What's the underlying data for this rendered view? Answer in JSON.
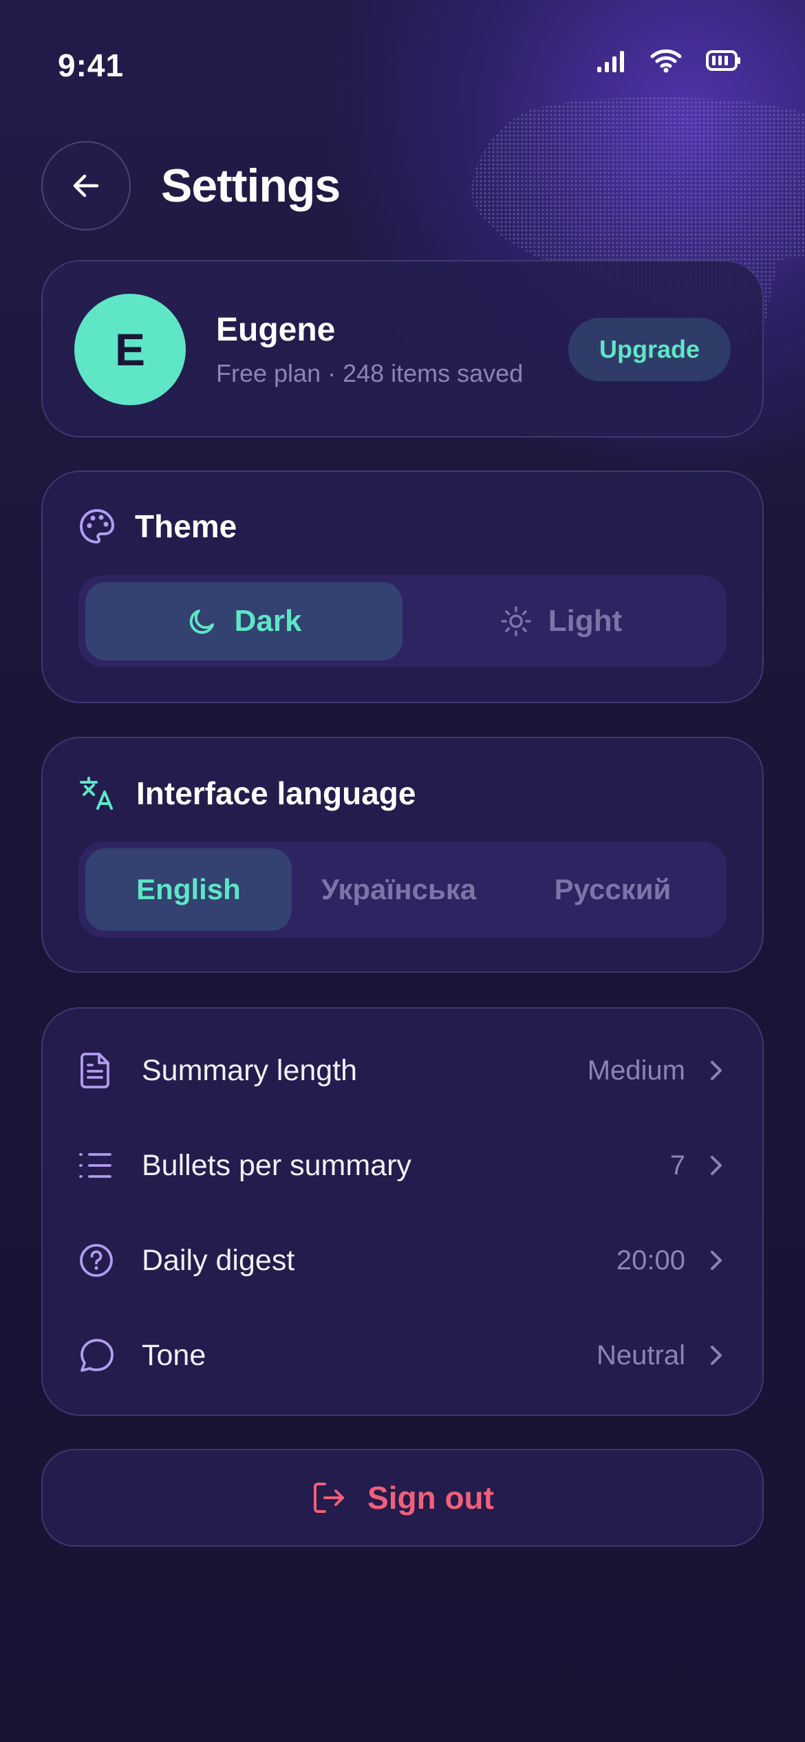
{
  "status_bar": {
    "time": "9:41"
  },
  "header": {
    "title": "Settings"
  },
  "profile": {
    "initial": "E",
    "name": "Eugene",
    "subtitle": "Free plan · 248 items saved",
    "upgrade_label": "Upgrade"
  },
  "theme": {
    "title": "Theme",
    "options": [
      {
        "label": "Dark",
        "icon": "moon-icon",
        "selected": true
      },
      {
        "label": "Light",
        "icon": "sun-icon",
        "selected": false
      }
    ]
  },
  "language": {
    "title": "Interface language",
    "options": [
      {
        "label": "English",
        "selected": true
      },
      {
        "label": "Українська",
        "selected": false
      },
      {
        "label": "Русский",
        "selected": false
      }
    ]
  },
  "preferences": {
    "items": [
      {
        "label": "Summary length",
        "value": "Medium",
        "icon": "document-icon"
      },
      {
        "label": "Bullets per summary",
        "value": "7",
        "icon": "list-icon"
      },
      {
        "label": "Daily digest",
        "value": "20:00",
        "icon": "help-circle-icon"
      },
      {
        "label": "Tone",
        "value": "Neutral",
        "icon": "chat-bubble-icon"
      }
    ]
  },
  "sign_out": {
    "label": "Sign out",
    "icon": "logout-icon"
  },
  "colors": {
    "accent": "#5ee6c6",
    "danger": "#f0607a",
    "background": "#1a1535",
    "card": "#241e50",
    "muted_text": "#8c84b5"
  }
}
